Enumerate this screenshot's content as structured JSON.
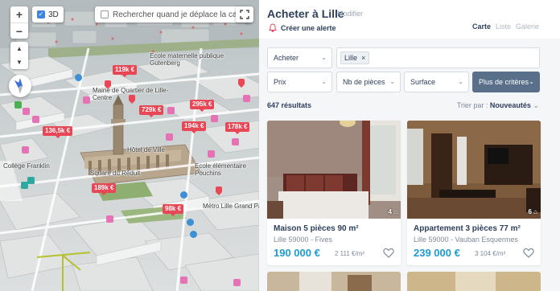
{
  "map": {
    "zoom_in": "+",
    "zoom_out": "−",
    "tilt_up": "▲",
    "tilt_down": "▼",
    "toggle_3d_label": "3D",
    "toggle_3d_checked": true,
    "search_on_move_label": "Rechercher quand je déplace la carte",
    "search_on_move_checked": false,
    "fullscreen_icon": "fullscreen-icon",
    "price_markers": [
      "119k €",
      "729k €",
      "295k €",
      "136,5k €",
      "194k €",
      "178k €",
      "189k €",
      "98k €"
    ],
    "labels": [
      "Ecole maternelle publique Gutenberg",
      "Maine de Quartier de Lille-Centre",
      "Hôtel de Ville",
      "Collège Franklin",
      "Square du Réduit",
      "Ecole élémentaire Pouchins",
      "Métro Lille Grand Pal"
    ],
    "colors": {
      "marker": "#e84855",
      "poi_pink": "#e472b4",
      "poi_teal": "#2fa8a0"
    }
  },
  "header": {
    "title": "Acheter à Lille",
    "modify": "Modifier",
    "create_alert": "Créer une alerte",
    "views": [
      "Carte",
      "Liste",
      "Galerie"
    ],
    "active_view": "Carte"
  },
  "filters": {
    "transaction": "Acheter",
    "location_tag": "Lille",
    "price": "Prix",
    "rooms": "Nb de pièces",
    "surface": "Surface",
    "more": "Plus de critères"
  },
  "results": {
    "count_label": "647 résultats",
    "sort_prefix": "Trier par :",
    "sort_value": "Nouveautés"
  },
  "listings": [
    {
      "title": "Maison 5 pièces 90 m²",
      "location": "Lille 59000 - Fives",
      "price": "190 000 €",
      "price_m2": "2 111 €/m²",
      "photos": "4"
    },
    {
      "title": "Appartement 3 pièces 77 m²",
      "location": "Lille 59000 - Vauban Esquermes",
      "price": "239 000 €",
      "price_m2": "3 104 €/m²",
      "photos": "6"
    }
  ],
  "accent_color": "#1d9bd1"
}
